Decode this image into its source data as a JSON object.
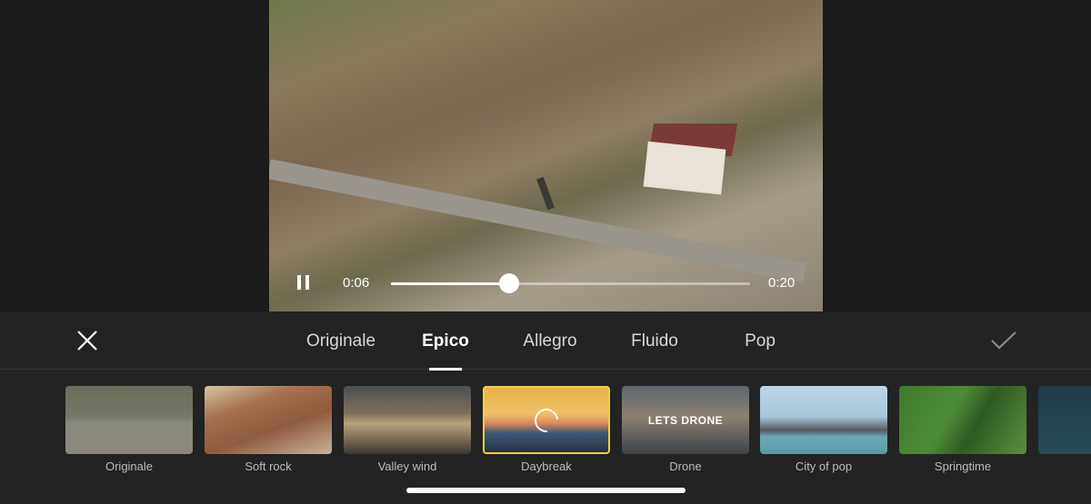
{
  "player": {
    "current_time": "0:06",
    "duration": "0:20",
    "progress": 0.33,
    "state": "playing"
  },
  "tabs": [
    {
      "label": "Originale",
      "active": false
    },
    {
      "label": "Epico",
      "active": true
    },
    {
      "label": "Allegro",
      "active": false
    },
    {
      "label": "Fluido",
      "active": false
    },
    {
      "label": "Pop",
      "active": false
    }
  ],
  "actions": {
    "close_icon": "close-icon",
    "confirm_icon": "checkmark-icon"
  },
  "selected_color": "#f2d13c",
  "templates": [
    {
      "label": "Originale",
      "bg": "linear-gradient(180deg,#6b6e5a 0%,#77776a 45%,#8a8a80 55%,#8c877b 100%)"
    },
    {
      "label": "Soft rock",
      "bg": "linear-gradient(160deg,#d9c6a4 0%,#a8714f 30%,#8f5a3e 60%,#c7b49a 100%)"
    },
    {
      "label": "Valley wind",
      "bg": "linear-gradient(180deg,#4b4f52 0%,#7e6f5a 40%,#b8a37e 55%,#3b3630 100%)"
    },
    {
      "label": "Daybreak",
      "bg": "linear-gradient(180deg,#e7b34a 0%,#f0c16a 40%,#d98a5e 55%,#3d5a78 70%,#243244 100%)",
      "selected": true,
      "loading": true
    },
    {
      "label": "Drone",
      "bg": "linear-gradient(180deg,#5d6670 0%,#8c8072 45%,#3c4248 100%)",
      "overlay": "LETS DRONE"
    },
    {
      "label": "City of pop",
      "bg": "linear-gradient(180deg,#bcd6e8 0%,#a9c6da 45%,#555a60 65%,#6aa9b4 75%,#5b9aa6 100%)"
    },
    {
      "label": "Springtime",
      "bg": "linear-gradient(120deg,#3d7a2c 0%,#4d8c36 40%,#2f5a22 60%,#5d8f3c 100%)"
    },
    {
      "label": "",
      "bg": "linear-gradient(180deg,#1f3b48 0%,#2a4a58 100%)"
    }
  ]
}
